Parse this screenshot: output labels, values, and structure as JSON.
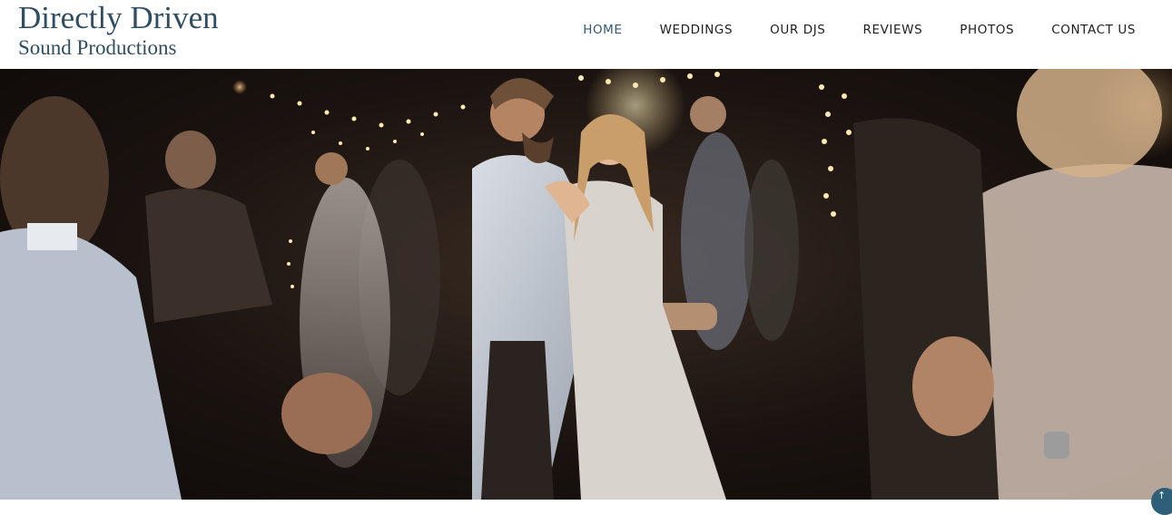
{
  "logo": {
    "title": "Directly Driven",
    "subtitle": "Sound Productions"
  },
  "nav": {
    "items": [
      {
        "label": "HOME",
        "active": true
      },
      {
        "label": "WEDDINGS"
      },
      {
        "label": "OUR DJS"
      },
      {
        "label": "REVIEWS"
      },
      {
        "label": "PHOTOS"
      },
      {
        "label": "CONTACT US"
      }
    ]
  },
  "colors": {
    "brand": "#2f4d63",
    "active_nav": "#2f5a76",
    "scroll_button": "#2e5e78"
  },
  "scroll_top": {
    "icon": "arrow-up-icon",
    "glyph": "↑"
  }
}
